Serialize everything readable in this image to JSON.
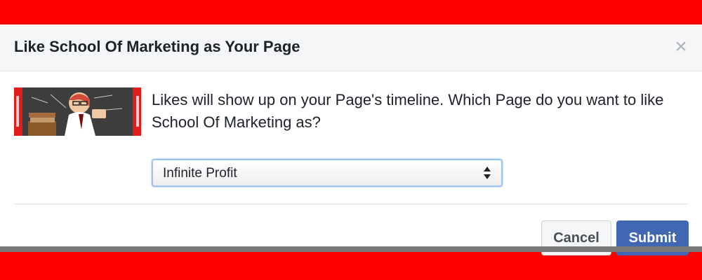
{
  "dialog": {
    "title": "Like School Of Marketing as Your Page",
    "close_icon": "close-icon",
    "message": "Likes will show up on your Page's timeline. Which Page do you want to like School Of Marketing as?",
    "page_select": {
      "selected_value": "Infinite Profit",
      "arrow_icon": "up-down-arrows-icon"
    },
    "thumbnail": "page-thumbnail-image",
    "buttons": {
      "cancel_label": "Cancel",
      "submit_label": "Submit"
    }
  },
  "colors": {
    "background_red": "#ff0000",
    "submit_blue": "#4267b2",
    "header_gray": "#f5f6f7"
  }
}
